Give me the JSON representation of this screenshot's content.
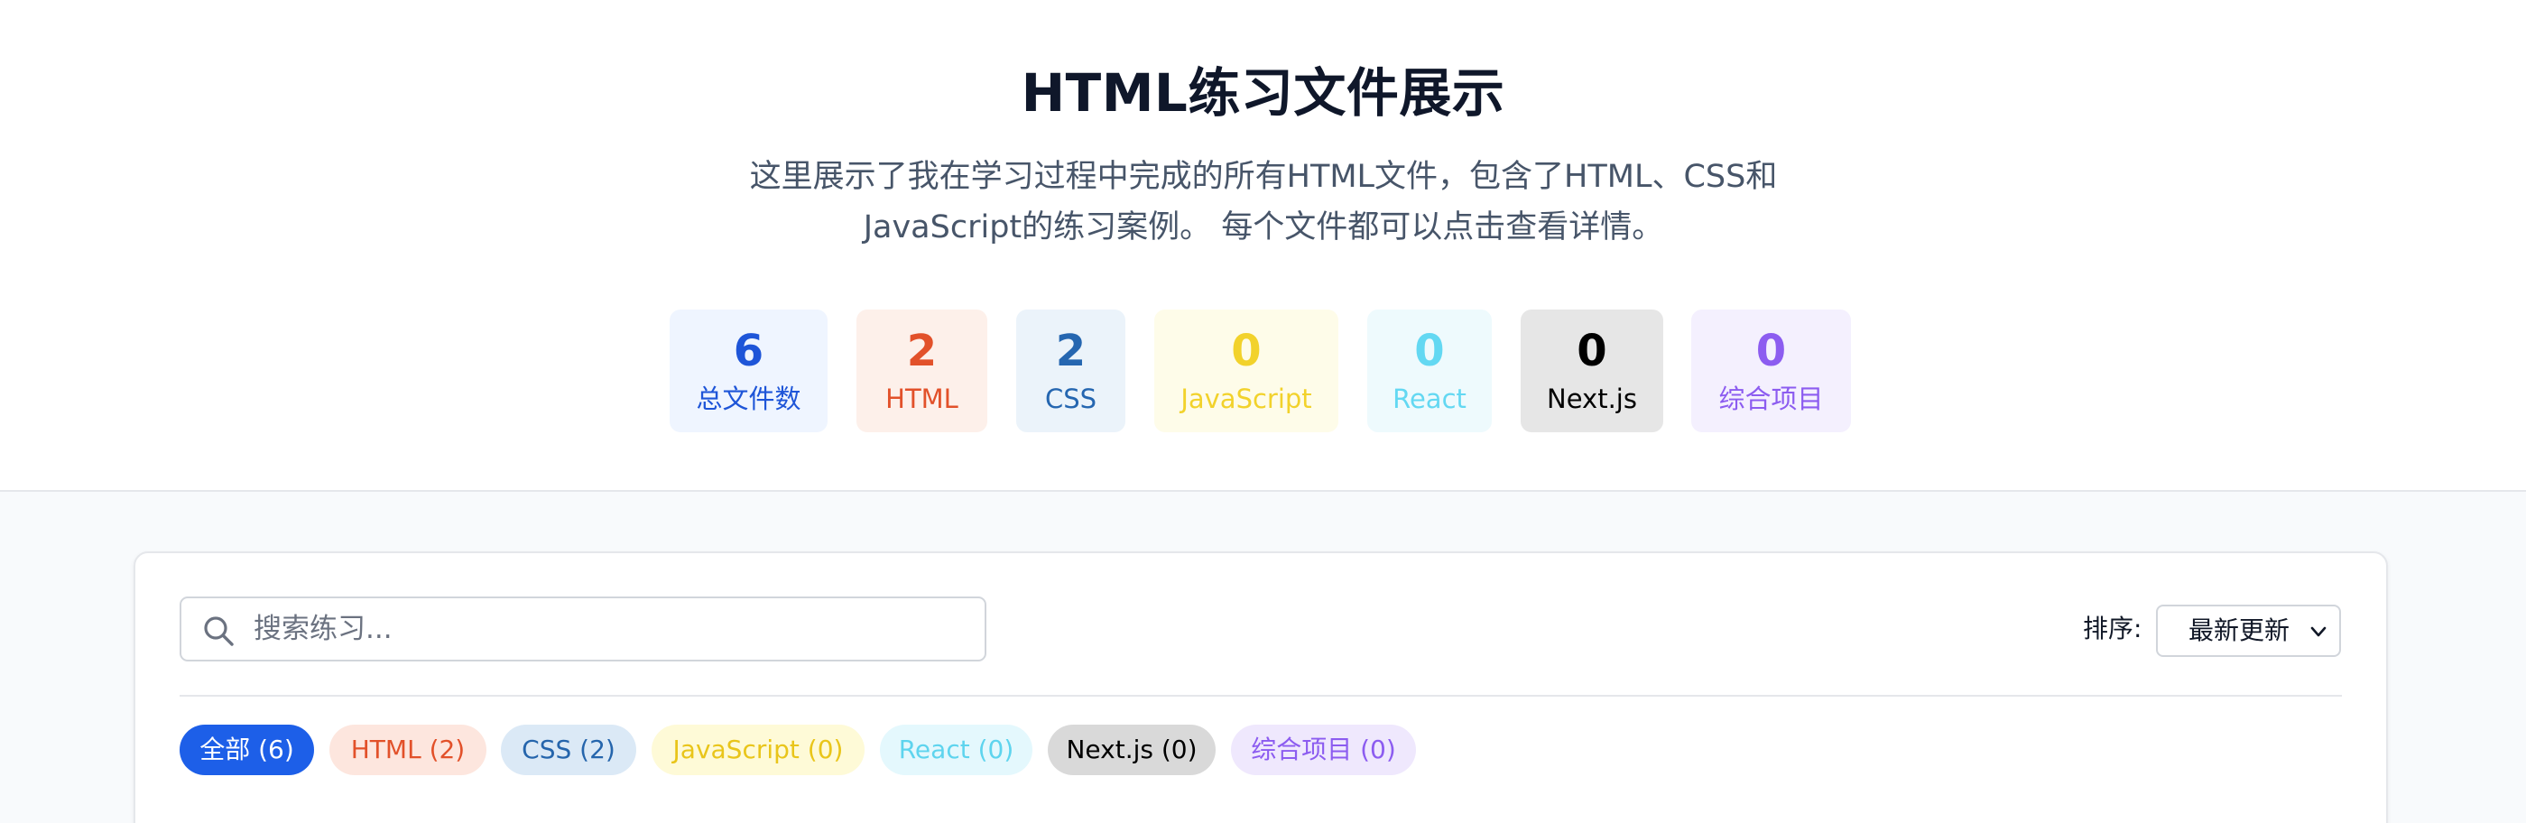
{
  "header": {
    "title": "HTML练习文件展示",
    "subtitle_line1": "这里展示了我在学习过程中完成的所有HTML文件，包含了HTML、CSS和",
    "subtitle_line2": "JavaScript的练习案例。 每个文件都可以点击查看详情。"
  },
  "stats": [
    {
      "value": "6",
      "label": "总文件数",
      "color": "#1e55d8",
      "bg": "#eff5ff"
    },
    {
      "value": "2",
      "label": "HTML",
      "color": "#e2512a",
      "bg": "#fdf0ea"
    },
    {
      "value": "2",
      "label": "CSS",
      "color": "#2566b0",
      "bg": "#ebf3fa"
    },
    {
      "value": "0",
      "label": "JavaScript",
      "color": "#f2d22b",
      "bg": "#fefce9"
    },
    {
      "value": "0",
      "label": "React",
      "color": "#63d8f2",
      "bg": "#eefafd"
    },
    {
      "value": "0",
      "label": "Next.js",
      "color": "#000000",
      "bg": "#e6e6e6"
    },
    {
      "value": "0",
      "label": "综合项目",
      "color": "#8c5cf0",
      "bg": "#f4f0fe"
    }
  ],
  "search": {
    "placeholder": "搜索练习..."
  },
  "sort": {
    "label": "排序:",
    "selected": "最新更新"
  },
  "filters": [
    {
      "label": "全部 (6)",
      "color": "#ffffff",
      "bg": "#1d5fe8",
      "active": true
    },
    {
      "label": "HTML (2)",
      "color": "#e2512a",
      "bg": "#fde6de"
    },
    {
      "label": "CSS (2)",
      "color": "#2565ac",
      "bg": "#dbe9f6"
    },
    {
      "label": "JavaScript (0)",
      "color": "#e9c51a",
      "bg": "#fefad7"
    },
    {
      "label": "React (0)",
      "color": "#5ed4ee",
      "bg": "#e4f8fd"
    },
    {
      "label": "Next.js (0)",
      "color": "#000000",
      "bg": "#d9d9d9"
    },
    {
      "label": "综合项目 (0)",
      "color": "#8c5cf0",
      "bg": "#efe8fd"
    }
  ]
}
